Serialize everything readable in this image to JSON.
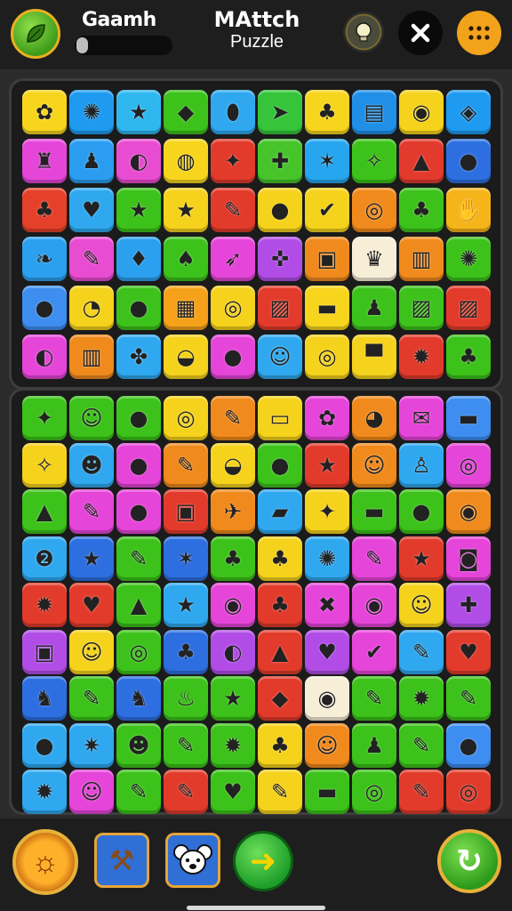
{
  "header": {
    "player_name": "Gaamh",
    "progress": 0.12,
    "title": "MAttch",
    "subtitle": "Puzzle",
    "icons": {
      "leaf": "leaf-icon",
      "hint": "lightbulb-icon",
      "close": "close-icon",
      "menu": "grid-menu-icon"
    }
  },
  "boards": {
    "top": {
      "rows": 6,
      "cols": 10,
      "tiles": [
        {
          "color": "#f7d51d",
          "icon": "✿"
        },
        {
          "color": "#1e9bf0",
          "icon": "✺"
        },
        {
          "color": "#2fb8f0",
          "icon": "★"
        },
        {
          "color": "#3cc21a",
          "icon": "◆"
        },
        {
          "color": "#2fa8ef",
          "icon": "⬮"
        },
        {
          "color": "#36c43a",
          "icon": "➤"
        },
        {
          "color": "#f7d51d",
          "icon": "♣"
        },
        {
          "color": "#1f8fe8",
          "icon": "▤"
        },
        {
          "color": "#f5d21c",
          "icon": "◉"
        },
        {
          "color": "#1e9bf0",
          "icon": "◈"
        },
        {
          "color": "#e545d8",
          "icon": "♜"
        },
        {
          "color": "#2a9df0",
          "icon": "♟"
        },
        {
          "color": "#e84cd0",
          "icon": "◐"
        },
        {
          "color": "#f7d51d",
          "icon": "◍"
        },
        {
          "color": "#e23b2b",
          "icon": "✦"
        },
        {
          "color": "#46c42a",
          "icon": "✚"
        },
        {
          "color": "#25a6ee",
          "icon": "✶"
        },
        {
          "color": "#3cc21a",
          "icon": "✧"
        },
        {
          "color": "#e33a2e",
          "icon": "▲"
        },
        {
          "color": "#2d6fe0",
          "icon": "●"
        },
        {
          "color": "#e4402a",
          "icon": "♣"
        },
        {
          "color": "#2fa8ef",
          "icon": "♥"
        },
        {
          "color": "#3cc21a",
          "icon": "★"
        },
        {
          "color": "#f5d21c",
          "icon": "★"
        },
        {
          "color": "#e23b2b",
          "icon": "✎"
        },
        {
          "color": "#f5d21c",
          "icon": "●"
        },
        {
          "color": "#f5d21c",
          "icon": "✔"
        },
        {
          "color": "#f08a1c",
          "icon": "◎"
        },
        {
          "color": "#3cc21a",
          "icon": "♣"
        },
        {
          "color": "#f5b41a",
          "icon": "✋"
        },
        {
          "color": "#2aa0ee",
          "icon": "❧"
        },
        {
          "color": "#e84cd0",
          "icon": "✎"
        },
        {
          "color": "#2aa0ee",
          "icon": "♦"
        },
        {
          "color": "#3cc21a",
          "icon": "♠"
        },
        {
          "color": "#e545d8",
          "icon": "➶"
        },
        {
          "color": "#b14de6",
          "icon": "✜"
        },
        {
          "color": "#f08a1c",
          "icon": "▣"
        },
        {
          "color": "#f7eed8",
          "icon": "♛"
        },
        {
          "color": "#f08a1c",
          "icon": "▥"
        },
        {
          "color": "#3cc21a",
          "icon": "✺"
        },
        {
          "color": "#3d8ef0",
          "icon": "●"
        },
        {
          "color": "#f5d21c",
          "icon": "◔"
        },
        {
          "color": "#3cc21a",
          "icon": "●"
        },
        {
          "color": "#f5a21a",
          "icon": "▦"
        },
        {
          "color": "#f5d21c",
          "icon": "◎"
        },
        {
          "color": "#e23b2b",
          "icon": "▨"
        },
        {
          "color": "#f7d51d",
          "icon": "▬"
        },
        {
          "color": "#3cc21a",
          "icon": "♟"
        },
        {
          "color": "#3cc21a",
          "icon": "▨"
        },
        {
          "color": "#e23b2b",
          "icon": "▨"
        },
        {
          "color": "#e545d8",
          "icon": "◐"
        },
        {
          "color": "#f08a1c",
          "icon": "▥"
        },
        {
          "color": "#2fa8ef",
          "icon": "✤"
        },
        {
          "color": "#f5d21c",
          "icon": "◒"
        },
        {
          "color": "#e545d8",
          "icon": "●"
        },
        {
          "color": "#2fa8ef",
          "icon": "☺"
        },
        {
          "color": "#f5d21c",
          "icon": "◎"
        },
        {
          "color": "#f5d21c",
          "icon": "▀"
        },
        {
          "color": "#e23b2b",
          "icon": "✹"
        },
        {
          "color": "#3cc21a",
          "icon": "♣"
        }
      ]
    },
    "bottom": {
      "rows": 9,
      "cols": 10,
      "tiles": [
        {
          "color": "#3cc21a",
          "icon": "✦"
        },
        {
          "color": "#3cc21a",
          "icon": "☺"
        },
        {
          "color": "#3cc21a",
          "icon": "●"
        },
        {
          "color": "#f5d21c",
          "icon": "◎"
        },
        {
          "color": "#f08a1c",
          "icon": "✎"
        },
        {
          "color": "#f5d21c",
          "icon": "▭"
        },
        {
          "color": "#e545d8",
          "icon": "✿"
        },
        {
          "color": "#f08a1c",
          "icon": "◕"
        },
        {
          "color": "#e545d8",
          "icon": "✉"
        },
        {
          "color": "#3d8ef0",
          "icon": "▬"
        },
        {
          "color": "#f5d21c",
          "icon": "✧"
        },
        {
          "color": "#2fa8ef",
          "icon": "☻"
        },
        {
          "color": "#e545d8",
          "icon": "●"
        },
        {
          "color": "#f08a1c",
          "icon": "✎"
        },
        {
          "color": "#f5d21c",
          "icon": "◒"
        },
        {
          "color": "#3cc21a",
          "icon": "●"
        },
        {
          "color": "#e23b2b",
          "icon": "★"
        },
        {
          "color": "#f08a1c",
          "icon": "☺"
        },
        {
          "color": "#2fa8ef",
          "icon": "♙"
        },
        {
          "color": "#e545d8",
          "icon": "◎"
        },
        {
          "color": "#3cc21a",
          "icon": "▲"
        },
        {
          "color": "#e545d8",
          "icon": "✎"
        },
        {
          "color": "#e545d8",
          "icon": "●"
        },
        {
          "color": "#e23b2b",
          "icon": "▣"
        },
        {
          "color": "#f08a1c",
          "icon": "✈"
        },
        {
          "color": "#2fa8ef",
          "icon": "▰"
        },
        {
          "color": "#f5d21c",
          "icon": "✦"
        },
        {
          "color": "#3cc21a",
          "icon": "▬"
        },
        {
          "color": "#3cc21a",
          "icon": "●"
        },
        {
          "color": "#f08a1c",
          "icon": "◉"
        },
        {
          "color": "#2fa8ef",
          "icon": "❷"
        },
        {
          "color": "#2d6fe0",
          "icon": "★"
        },
        {
          "color": "#3cc21a",
          "icon": "✎"
        },
        {
          "color": "#2d6fe0",
          "icon": "✶"
        },
        {
          "color": "#3cc21a",
          "icon": "♣"
        },
        {
          "color": "#f5d21c",
          "icon": "♣"
        },
        {
          "color": "#2fa8ef",
          "icon": "✺"
        },
        {
          "color": "#e545d8",
          "icon": "✎"
        },
        {
          "color": "#e23b2b",
          "icon": "★"
        },
        {
          "color": "#e545d8",
          "icon": "◙"
        },
        {
          "color": "#e23b2b",
          "icon": "✹"
        },
        {
          "color": "#e23b2b",
          "icon": "♥"
        },
        {
          "color": "#3cc21a",
          "icon": "▲"
        },
        {
          "color": "#2fa8ef",
          "icon": "★"
        },
        {
          "color": "#e545d8",
          "icon": "◉"
        },
        {
          "color": "#e23b2b",
          "icon": "♣"
        },
        {
          "color": "#e545d8",
          "icon": "✖"
        },
        {
          "color": "#e545d8",
          "icon": "◉"
        },
        {
          "color": "#f5d21c",
          "icon": "☺"
        },
        {
          "color": "#b14de6",
          "icon": "✚"
        },
        {
          "color": "#b14de6",
          "icon": "▣"
        },
        {
          "color": "#f5d21c",
          "icon": "☺"
        },
        {
          "color": "#3cc21a",
          "icon": "◎"
        },
        {
          "color": "#2d6fe0",
          "icon": "♣"
        },
        {
          "color": "#b14de6",
          "icon": "◐"
        },
        {
          "color": "#e23b2b",
          "icon": "▲"
        },
        {
          "color": "#b14de6",
          "icon": "♥"
        },
        {
          "color": "#e545d8",
          "icon": "✔"
        },
        {
          "color": "#2fa8ef",
          "icon": "✎"
        },
        {
          "color": "#e23b2b",
          "icon": "♥"
        },
        {
          "color": "#2d6fe0",
          "icon": "♞"
        },
        {
          "color": "#3cc21a",
          "icon": "✎"
        },
        {
          "color": "#2d6fe0",
          "icon": "♞"
        },
        {
          "color": "#3cc21a",
          "icon": "♨"
        },
        {
          "color": "#3cc21a",
          "icon": "★"
        },
        {
          "color": "#e23b2b",
          "icon": "◆"
        },
        {
          "color": "#f7eed8",
          "icon": "◉"
        },
        {
          "color": "#3cc21a",
          "icon": "✎"
        },
        {
          "color": "#3cc21a",
          "icon": "✹"
        },
        {
          "color": "#3cc21a",
          "icon": "✎"
        },
        {
          "color": "#2fa8ef",
          "icon": "●"
        },
        {
          "color": "#2fa8ef",
          "icon": "✷"
        },
        {
          "color": "#3cc21a",
          "icon": "☻"
        },
        {
          "color": "#3cc21a",
          "icon": "✎"
        },
        {
          "color": "#3cc21a",
          "icon": "✹"
        },
        {
          "color": "#f5d21c",
          "icon": "♣"
        },
        {
          "color": "#f08a1c",
          "icon": "☺"
        },
        {
          "color": "#3cc21a",
          "icon": "♟"
        },
        {
          "color": "#3cc21a",
          "icon": "✎"
        },
        {
          "color": "#3d8ef0",
          "icon": "●"
        },
        {
          "color": "#2fa8ef",
          "icon": "✹"
        },
        {
          "color": "#e545d8",
          "icon": "☺"
        },
        {
          "color": "#3cc21a",
          "icon": "✎"
        },
        {
          "color": "#e23b2b",
          "icon": "✎"
        },
        {
          "color": "#3cc21a",
          "icon": "♥"
        },
        {
          "color": "#f5d21c",
          "icon": "✎"
        },
        {
          "color": "#3cc21a",
          "icon": "▬"
        },
        {
          "color": "#3cc21a",
          "icon": "◎"
        },
        {
          "color": "#e23b2b",
          "icon": "✎"
        },
        {
          "color": "#e23b2b",
          "icon": "◎"
        }
      ]
    }
  },
  "bottom_bar": {
    "buttons": [
      {
        "name": "sun-powerup-button",
        "icon": "sun-icon"
      },
      {
        "name": "hammer-powerup-button",
        "icon": "hammer-icon"
      },
      {
        "name": "koala-powerup-button",
        "icon": "koala-icon"
      },
      {
        "name": "next-button",
        "icon": "arrow-right-icon"
      },
      {
        "name": "restart-button",
        "icon": "restart-icon"
      }
    ]
  }
}
